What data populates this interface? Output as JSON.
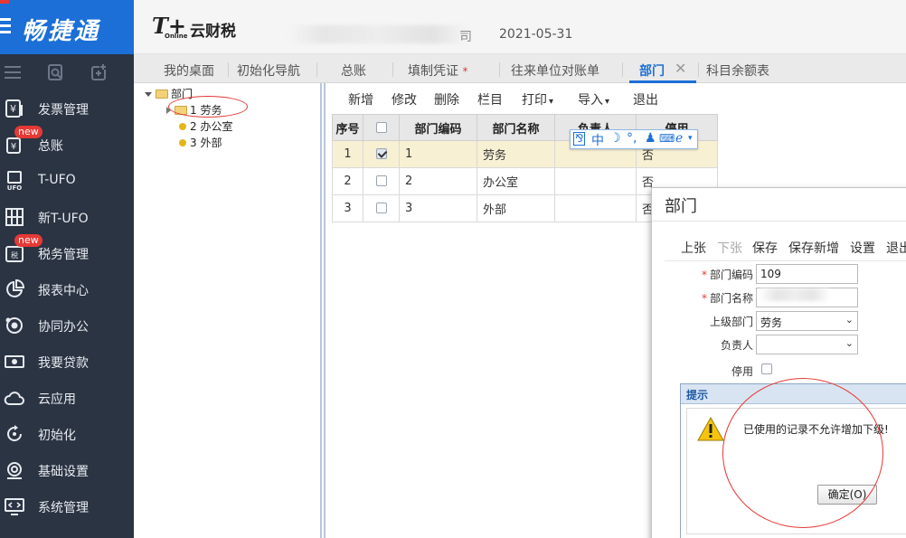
{
  "brand": {
    "name": "畅捷通"
  },
  "sidebar": {
    "items": [
      {
        "label": "发票管理",
        "icon": "invoice-icon",
        "badge": ""
      },
      {
        "label": "总账",
        "icon": "ledger-icon",
        "badge": "new"
      },
      {
        "label": "T-UFO",
        "icon": "ufo-icon",
        "badge": ""
      },
      {
        "label": "新T-UFO",
        "icon": "new-ufo-icon",
        "badge": ""
      },
      {
        "label": "税务管理",
        "icon": "tax-icon",
        "badge": "new"
      },
      {
        "label": "报表中心",
        "icon": "report-icon",
        "badge": ""
      },
      {
        "label": "协同办公",
        "icon": "collaboration-icon",
        "badge": ""
      },
      {
        "label": "我要贷款",
        "icon": "loan-icon",
        "badge": ""
      },
      {
        "label": "云应用",
        "icon": "cloud-icon",
        "badge": ""
      },
      {
        "label": "初始化",
        "icon": "init-icon",
        "badge": ""
      },
      {
        "label": "基础设置",
        "icon": "settings-icon",
        "badge": ""
      },
      {
        "label": "系统管理",
        "icon": "system-icon",
        "badge": ""
      }
    ]
  },
  "header": {
    "logo_tt": "T+",
    "logo_online": "Online",
    "logo_text": "云财税",
    "company_suffix": "司",
    "date": "2021-05-31"
  },
  "tabs": [
    {
      "label": "我的桌面",
      "active": false,
      "required": false
    },
    {
      "label": "初始化导航",
      "active": false,
      "required": false
    },
    {
      "label": "总账",
      "active": false,
      "required": false
    },
    {
      "label": "填制凭证",
      "active": false,
      "required": true
    },
    {
      "label": "往来单位对账单",
      "active": false,
      "required": false
    },
    {
      "label": "部门",
      "active": true,
      "required": false
    },
    {
      "label": "科目余额表",
      "active": false,
      "required": false
    }
  ],
  "tab_close_glyph": "✕",
  "tab_required_mark": "*",
  "tree": {
    "root": "部门",
    "children": [
      {
        "label": "1 劳务",
        "type": "folder"
      },
      {
        "label": "2 办公室",
        "type": "leaf"
      },
      {
        "label": "3 外部",
        "type": "leaf"
      }
    ]
  },
  "toolbar": {
    "add": "新增",
    "edit": "修改",
    "delete": "删除",
    "columns": "栏目",
    "print": "打印",
    "import": "导入",
    "exit": "退出"
  },
  "grid": {
    "headers": [
      "序号",
      "",
      "部门编码",
      "部门名称",
      "负责人",
      "停用"
    ],
    "rows": [
      {
        "seq": "1",
        "checked": true,
        "code": "1",
        "name": "劳务",
        "manager": "",
        "disabled": "否"
      },
      {
        "seq": "2",
        "checked": false,
        "code": "2",
        "name": "办公室",
        "manager": "",
        "disabled": "否"
      },
      {
        "seq": "3",
        "checked": false,
        "code": "3",
        "name": "外部",
        "manager": "",
        "disabled": "否"
      }
    ]
  },
  "ime": {
    "mode": "中",
    "glyphs": "°,"
  },
  "dialog": {
    "title": "部门",
    "buttons": {
      "prev": "上张",
      "next": "下张",
      "save": "保存",
      "save_new": "保存新增",
      "settings": "设置",
      "exit": "退出"
    },
    "fields": {
      "code_label": "部门编码",
      "code_value": "109",
      "name_label": "部门名称",
      "parent_label": "上级部门",
      "parent_value": "劳务",
      "manager_label": "负责人",
      "manager_value": "",
      "disabled_label": "停用",
      "required_mark": "*"
    }
  },
  "message": {
    "title": "提示",
    "text": "已使用的记录不允许增加下级!",
    "ok": "确定(O)"
  },
  "colors": {
    "sidebar_bg": "#2b3443",
    "brand_blue": "#1c6fd6",
    "badge_red": "#e53935",
    "selected_row": "#f7f0d3",
    "annotation_red": "#e53935"
  }
}
